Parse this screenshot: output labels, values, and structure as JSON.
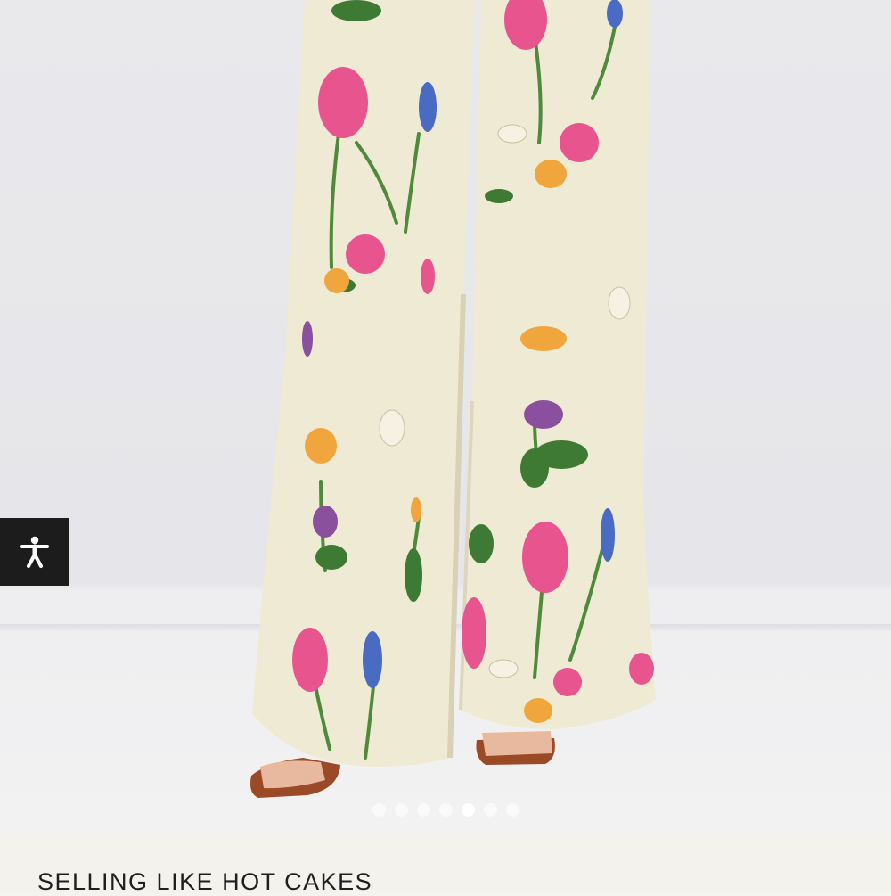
{
  "gallery": {
    "image_alt": "Wide-leg floral print trousers",
    "dot_count": 7,
    "active_index": 4
  },
  "accessibility": {
    "icon": "accessibility-person-icon",
    "label": "Accessibility"
  },
  "product": {
    "title": "SELLING LIKE HOT CAKES"
  },
  "colors": {
    "background": "#e8e8eb",
    "fabric": "#efead3",
    "info_bar": "#f4f2ec",
    "title_text": "#1f1f1f",
    "accessibility_button": "#1c1c1c"
  }
}
